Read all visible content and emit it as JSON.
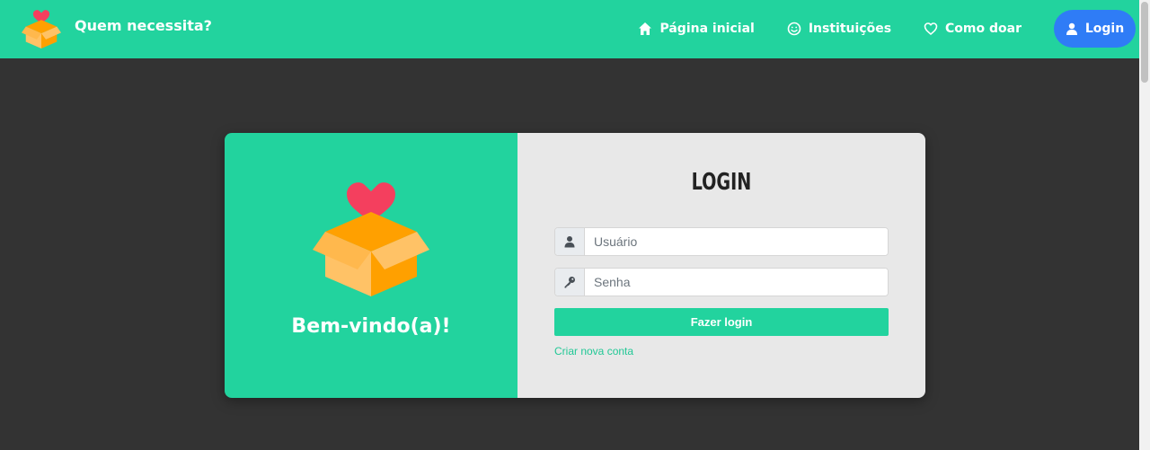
{
  "brand": {
    "name": "Quem necessita?",
    "logo_icon": "heart-box-icon"
  },
  "nav": {
    "items": [
      {
        "label": "Página inicial",
        "icon": "home-icon"
      },
      {
        "label": "Instituições",
        "icon": "smile-icon"
      },
      {
        "label": "Como doar",
        "icon": "heart-outline-icon"
      }
    ],
    "login_label": "Login",
    "login_icon": "user-icon"
  },
  "welcome_panel": {
    "heading": "Bem-vindo(a)!",
    "logo_icon": "heart-box-icon"
  },
  "login_form": {
    "title": "LOGIN",
    "username_placeholder": "Usuário",
    "password_placeholder": "Senha",
    "submit_label": "Fazer login",
    "create_account_label": "Criar nova conta"
  },
  "colors": {
    "accent": "#22d39e",
    "login_button": "#2f7cf6",
    "background": "#333333",
    "form_panel": "#e8e8e8",
    "box_orange": "#ffa000",
    "box_light": "#ffc266",
    "heart": "#f43f5e"
  }
}
